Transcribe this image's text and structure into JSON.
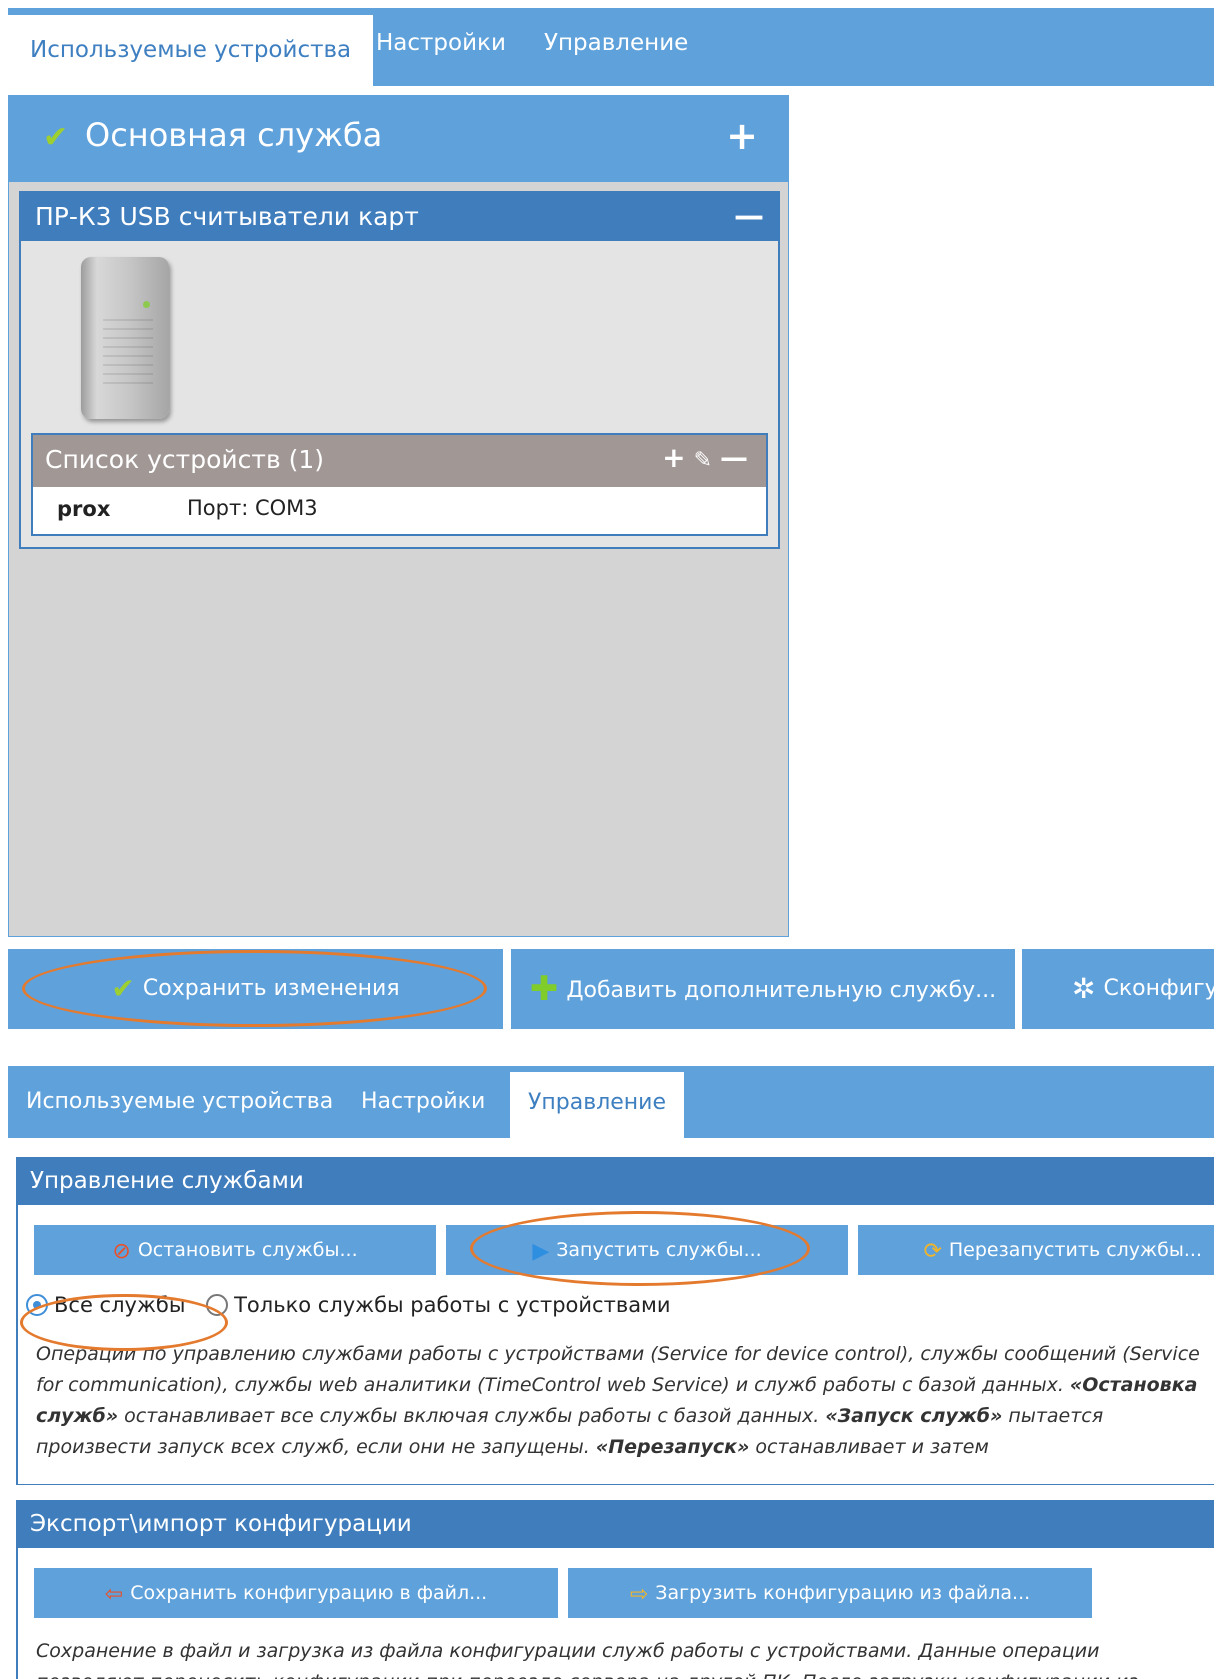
{
  "top": {
    "tabs": [
      "Используемые устройства",
      "Настройки",
      "Управление"
    ],
    "service": {
      "title": "Основная служба",
      "group": {
        "title": "ПР-К3 USB считыватели карт",
        "device_list": {
          "title": "Список устройств (1)",
          "rows": [
            {
              "name": "prox",
              "port": "Порт: COM3"
            }
          ]
        }
      }
    },
    "buttons": {
      "save": "Сохранить изменения",
      "add_service": "Добавить дополнительную службу...",
      "configure": "Сконфигу"
    }
  },
  "bottom": {
    "tabs": [
      "Используемые устройства",
      "Настройки",
      "Управление"
    ],
    "service_mgmt": {
      "title": "Управление службами",
      "stop": "Остановить службы...",
      "start": "Запустить службы...",
      "restart": "Перезапустить службы...",
      "radio_all": "Все службы",
      "radio_devices": "Только службы работы с устройствами",
      "desc": {
        "p1": "Операции по управлению службами работы с устройствами (Service for device control), службы сообщений (Service for communication), службы web аналитики (TimeControl web Service) и служб работы с базой данных. ",
        "b1": "«Остановка служб»",
        "p2": " останавливает все службы включая службы работы с базой данных. ",
        "b2": "«Запуск служб»",
        "p3": " пытается произвести запуск всех служб, если они не запущены. ",
        "b3": "«Перезапуск»",
        "p4": " останавливает и затем"
      }
    },
    "export": {
      "title": "Экспорт\\импорт конфигурации",
      "save_file": "Сохранить конфигурацию в файл...",
      "load_file": "Загрузить конфигурацию из файла...",
      "desc": "Сохранение в файл и загрузка из файла конфигурации служб работы с устройствами. Данные операции позволяют переносить конфигурации при переезде сервера на другой ПК. После загрузки конфигурации из"
    }
  },
  "colors": {
    "accent": "#5fa1db",
    "header_dark": "#3f7dbd",
    "highlight_oval": "#e47a2e",
    "check_green": "#9ccf2f"
  }
}
